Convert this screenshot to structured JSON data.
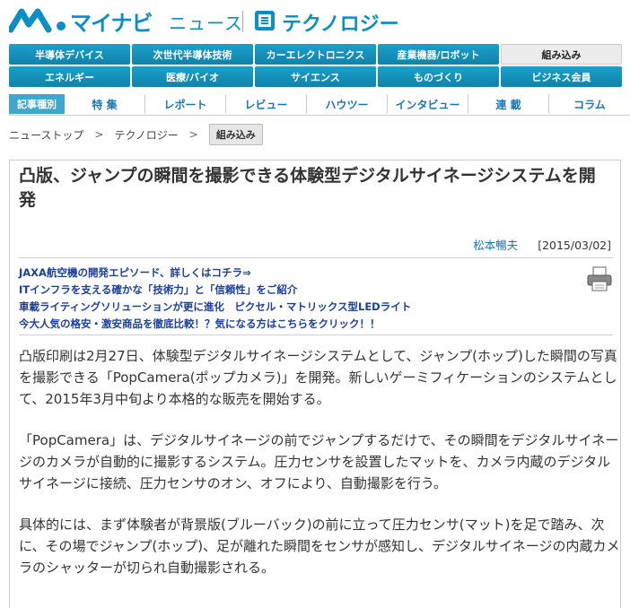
{
  "header": {
    "logo_text": "マイナビ",
    "news_text": "ニュース",
    "section_title": "テクノロジー"
  },
  "category_nav": {
    "row1": [
      "半導体デバイス",
      "次世代半導体技術",
      "カーエレクトロニクス",
      "産業機器/ロボット",
      "組み込み"
    ],
    "row2": [
      "エネルギー",
      "医療/バイオ",
      "サイエンス",
      "ものづくり",
      "ビジネス会員"
    ],
    "active": "組み込み"
  },
  "type_nav": {
    "label": "記事種別",
    "items": [
      "特 集",
      "レポート",
      "レビュー",
      "ハウツー",
      "インタビュー",
      "連 載",
      "コラム"
    ]
  },
  "breadcrumb": {
    "items": [
      "ニューストップ",
      "テクノロジー"
    ],
    "separator": ">",
    "current": "組み込み"
  },
  "article": {
    "title": "凸版、ジャンプの瞬間を撮影できる体験型デジタルサイネージシステムを開発",
    "author": "松本暢夫",
    "date": "[2015/03/02]",
    "promo_links": [
      "JAXA航空機の開発エピソード、詳しくはコチラ⇒",
      "ITインフラを支える確かな「技術力」と「信頼性」をご紹介",
      "車載ライティングソリューションが更に進化　ピクセル・マトリックス型LEDライト",
      "今大人気の格安・激安商品を徹底比較！？気になる方はこちらをクリック！！"
    ],
    "paragraphs": [
      "凸版印刷は2月27日、体験型デジタルサイネージシステムとして、ジャンプ(ホップ)した瞬間の写真を撮影できる「PopCamera(ポップカメラ)」を開発。新しいゲーミフィケーションのシステムとして、2015年3月中旬より本格的な販売を開始する。",
      "「PopCamera」は、デジタルサイネージの前でジャンプするだけで、その瞬間をデジタルサイネージのカメラが自動的に撮影するシステム。圧力センサを設置したマットを、カメラ内蔵のデジタルサイネージに接続、圧力センサのオン、オフにより、自動撮影を行う。",
      "具体的には、まず体験者が背景版(ブルーバック)の前に立って圧力センサ(マット)を足で踏み、次に、その場でジャンプ(ホップ)、足が離れた瞬間をセンサが感知し、デジタルサイネージの内蔵カメラのシャッターが切られ自動撮影される。"
    ]
  },
  "colors": {
    "brand": "#0a8ec6",
    "nav_bg": "#1596c0",
    "link": "#1a3fa0"
  }
}
